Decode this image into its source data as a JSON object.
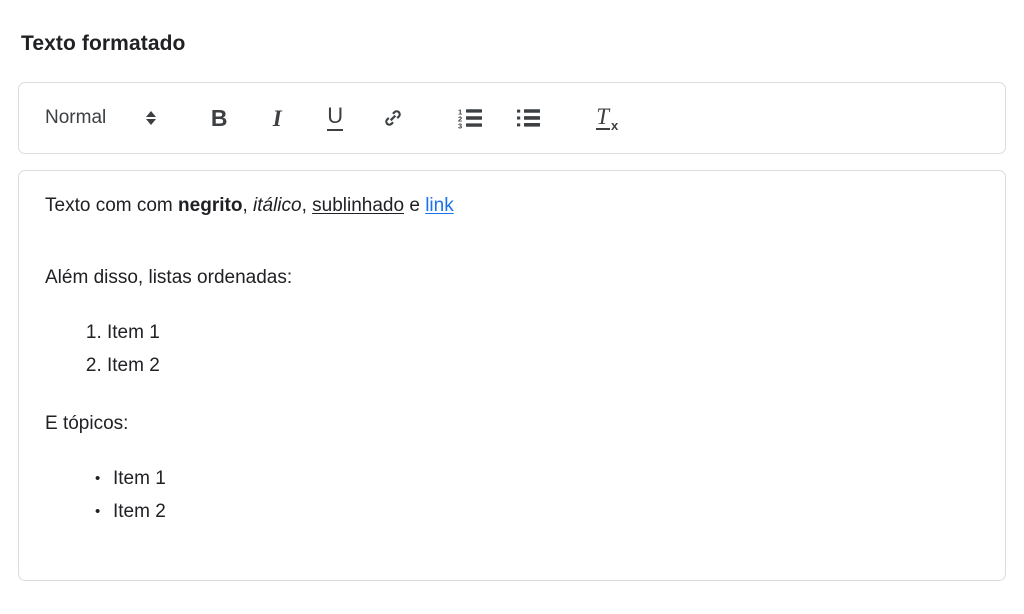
{
  "page": {
    "title": "Texto formatado",
    "accent_link_color": "#1a73e8",
    "border_color": "#dcdcdc",
    "text_color": "#202124"
  },
  "toolbar": {
    "format_select": {
      "value": "Normal",
      "icon": "chevron-up-down-icon"
    },
    "buttons": [
      {
        "name": "bold",
        "label": "B",
        "icon": "bold-icon",
        "title": "Negrito"
      },
      {
        "name": "italic",
        "label": "I",
        "icon": "italic-icon",
        "title": "Itálico"
      },
      {
        "name": "underline",
        "label": "U",
        "icon": "underline-icon",
        "title": "Sublinhado"
      },
      {
        "name": "link",
        "label": "",
        "icon": "link-icon",
        "title": "Link"
      },
      {
        "name": "ordered-list",
        "label": "",
        "icon": "ordered-list-icon",
        "title": "Lista ordenada"
      },
      {
        "name": "bullet-list",
        "label": "",
        "icon": "bullet-list-icon",
        "title": "Lista com marcadores"
      },
      {
        "name": "clear-format",
        "label": "",
        "icon": "clear-formatting-icon",
        "title": "Limpar formatação"
      }
    ],
    "clear_format_glyph": {
      "t": "T",
      "x": "x"
    },
    "ordered_list_numbers": [
      "1",
      "2",
      "3"
    ]
  },
  "editor": {
    "paragraph_1": {
      "lead": "Texto com com ",
      "bold": "negrito",
      "sep1": ", ",
      "italic": "itálico",
      "sep2": ", ",
      "underline": "sublinhado",
      "sep3": " e ",
      "link": "link"
    },
    "paragraph_2": "Além disso, listas ordenadas:",
    "ordered_list": [
      "Item 1",
      "Item 2"
    ],
    "paragraph_3": "E tópicos:",
    "bullet_list": [
      "Item 1",
      "Item 2"
    ],
    "bullet_char": "•"
  }
}
